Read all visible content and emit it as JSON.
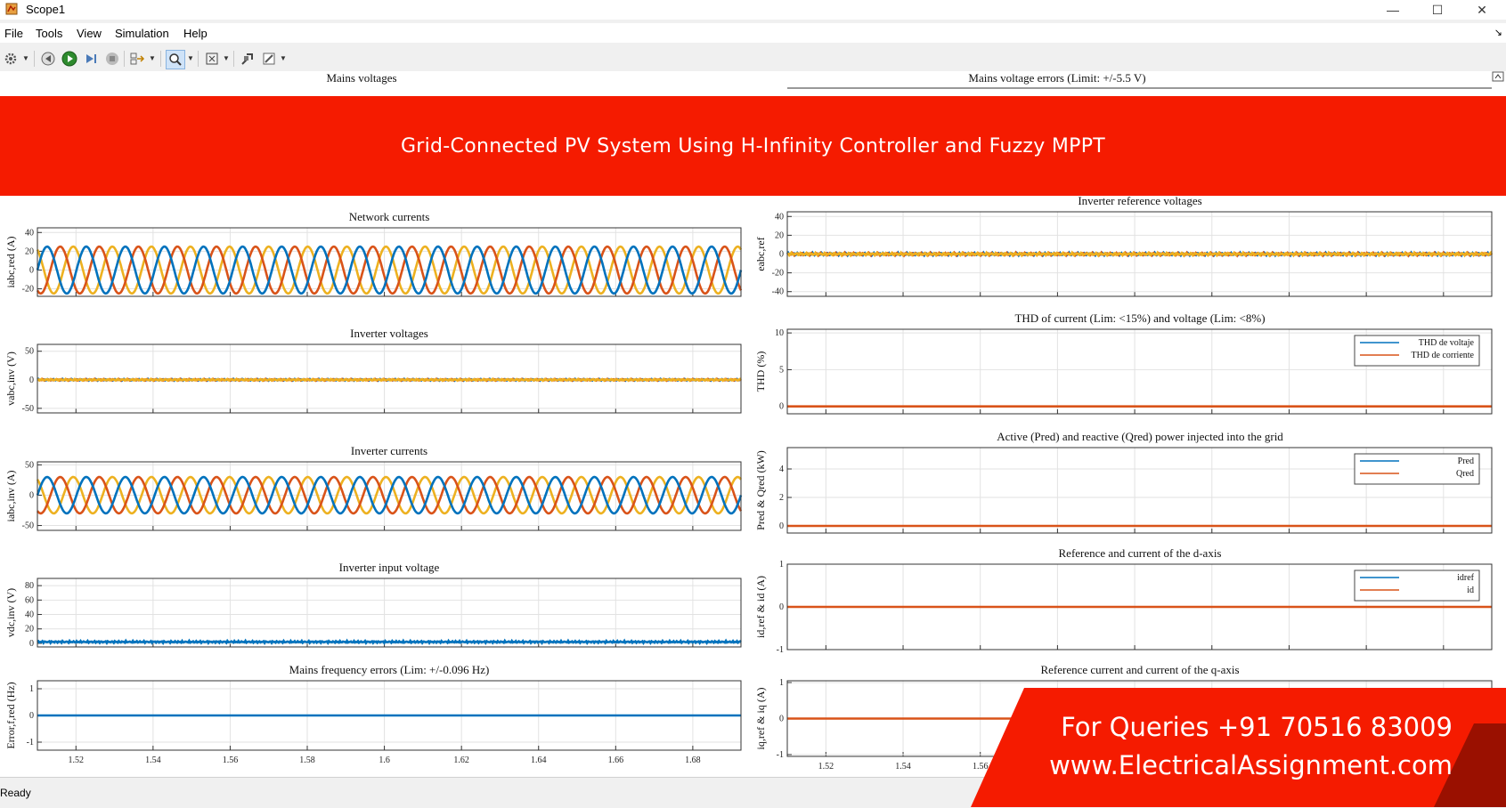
{
  "window": {
    "title": "Scope1"
  },
  "menu": [
    "File",
    "Tools",
    "View",
    "Simulation",
    "Help"
  ],
  "toolbar_icons": [
    "settings-icon",
    "step-back-icon",
    "run-icon",
    "step-forward-icon",
    "stop-icon",
    "highlight-block-icon",
    "zoom-icon",
    "fit-to-view-icon",
    "layout-icon",
    "style-icon"
  ],
  "banner": {
    "text": "Grid-Connected PV System Using H-Infinity Controller and Fuzzy MPPT"
  },
  "contact": {
    "line1": "For Queries +91 70516 83009",
    "line2": "www.ElectricalAssignment.com"
  },
  "status": {
    "text": "Ready"
  },
  "colors": {
    "blue": "#0072BD",
    "orange": "#D95319",
    "yellow": "#EDB120",
    "banner_red": "#f51b00"
  },
  "x_axis": {
    "range": [
      1.51,
      1.6925
    ],
    "ticks": [
      "1.52",
      "1.54",
      "1.56",
      "1.58",
      "1.6",
      "1.62",
      "1.64",
      "1.66",
      "1.68"
    ]
  },
  "panels": [
    {
      "id": "network-currents",
      "title": "Network currents",
      "ylabel": "iabc,red (A)",
      "yticks": [
        40,
        20,
        0,
        -20
      ],
      "ylim": [
        -28,
        45
      ],
      "type": "sine",
      "amplitude": 25,
      "cycles": 18,
      "noise": 0
    },
    {
      "id": "inverter-voltages",
      "title": "Inverter voltages",
      "ylabel": "vabc,inv (V)",
      "yticks": [
        50,
        0,
        -50
      ],
      "ylim": [
        -58,
        62
      ],
      "type": "noise",
      "amplitude": 1.5
    },
    {
      "id": "inverter-currents",
      "title": "Inverter currents",
      "ylabel": "iabc,inv (A)",
      "yticks": [
        50,
        0,
        -50
      ],
      "ylim": [
        -58,
        55
      ],
      "type": "sine",
      "amplitude": 30,
      "cycles": 18,
      "noise": 0
    },
    {
      "id": "inverter-input-voltage",
      "title": "Inverter input voltage",
      "ylabel": "vdc,inv (V)",
      "yticks": [
        80,
        60,
        40,
        20,
        0
      ],
      "ylim": [
        -5,
        90
      ],
      "type": "dc",
      "level": 2
    },
    {
      "id": "mains-frequency-errors",
      "title": "Mains frequency errors (Lim: +/-0.096 Hz)",
      "ylabel": "Error,f,red (Hz)",
      "yticks": [
        1,
        0,
        -1
      ],
      "ylim": [
        -1.3,
        1.3
      ],
      "type": "flat",
      "value": 0,
      "color": "#0072BD",
      "show_xticks": true
    },
    {
      "id": "inverter-reference-voltages",
      "title": "Inverter reference voltages",
      "ylabel": "eabc,ref",
      "yticks": [
        40,
        20,
        0,
        -20,
        -40
      ],
      "ylim": [
        -45,
        45
      ],
      "type": "noise",
      "amplitude": 1.5
    },
    {
      "id": "thd",
      "title": "THD of current (Lim: <15%) and voltage (Lim: <8%)",
      "ylabel": "THD (%)",
      "yticks": [
        10,
        5,
        0
      ],
      "ylim": [
        -1,
        10.5
      ],
      "type": "flat",
      "value": 0,
      "color": "#D95319",
      "legend": [
        "THD de voltaje",
        "THD de corriente"
      ]
    },
    {
      "id": "active-reactive-power",
      "title": "Active (Pred) and reactive (Qred) power injected into the grid",
      "ylabel": "Pred & Qred (kW)",
      "yticks": [
        4,
        2,
        0
      ],
      "ylim": [
        -0.5,
        5.5
      ],
      "type": "flat",
      "value": 0,
      "color": "#D95319",
      "legend": [
        "Pred",
        "Qred"
      ]
    },
    {
      "id": "d-axis",
      "title": "Reference and current of the d-axis",
      "ylabel": "id,ref & id (A)",
      "yticks": [
        1,
        0,
        -1
      ],
      "ylim": [
        -1,
        1
      ],
      "type": "flat",
      "value": 0,
      "color": "#D95319",
      "legend": [
        "idref",
        "id"
      ]
    },
    {
      "id": "q-axis",
      "title": "Reference current and current of the q-axis",
      "ylabel": "iq,ref & iq (A)",
      "yticks": [
        1,
        0,
        -1
      ],
      "ylim": [
        -1.05,
        1.05
      ],
      "type": "flat",
      "value": 0,
      "color": "#D95319",
      "show_xticks": true
    }
  ],
  "top_titles": [
    "Mains voltages",
    "Mains voltage errors (Limit: +/-5.5 V)"
  ]
}
